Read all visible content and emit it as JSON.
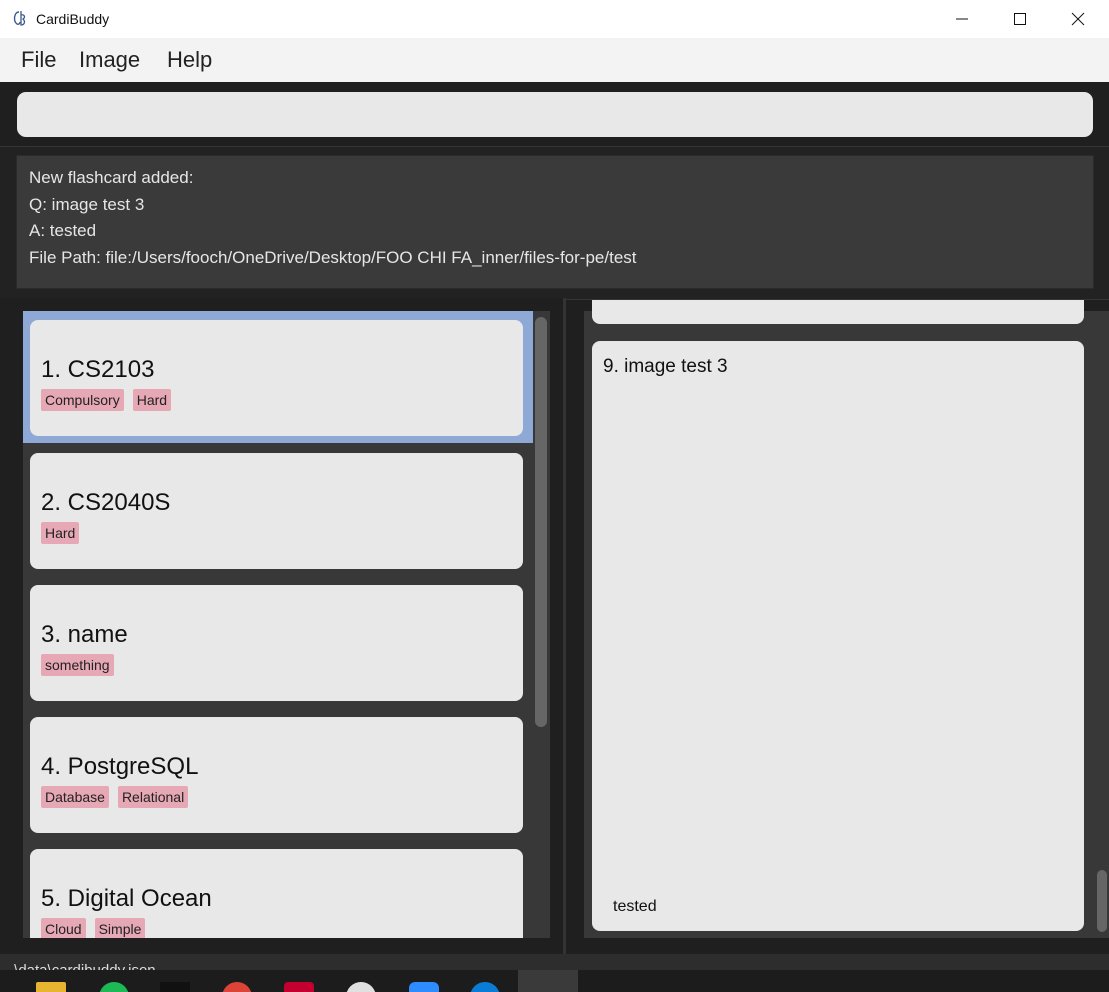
{
  "window": {
    "title": "CardiBuddy"
  },
  "menu": {
    "items": [
      "File",
      "Image",
      "Help"
    ]
  },
  "command": {
    "value": ""
  },
  "result": {
    "lines": [
      "New flashcard added:",
      "Q: image test 3",
      "A: tested",
      "File Path: file:/Users/fooch/OneDrive/Desktop/FOO CHI FA_inner/files-for-pe/test"
    ]
  },
  "list": {
    "items": [
      {
        "title": "1.  CS2103",
        "tags": [
          "Compulsory",
          "Hard"
        ]
      },
      {
        "title": "2.  CS2040S",
        "tags": [
          "Hard"
        ]
      },
      {
        "title": "3.  name",
        "tags": [
          "something"
        ]
      },
      {
        "title": "4.  PostgreSQL",
        "tags": [
          "Database",
          "Relational"
        ]
      },
      {
        "title": "5.  Digital Ocean",
        "tags": [
          "Cloud",
          "Simple"
        ]
      }
    ]
  },
  "detail": {
    "title": "9.  image test 3",
    "answer": "tested"
  },
  "status": {
    "path": ".\\data\\cardibuddy.json"
  },
  "colors": {
    "tag": "#e6a8b4",
    "selection": "#8ea9d6",
    "card": "#e8e8e8",
    "panel": "#383838"
  }
}
